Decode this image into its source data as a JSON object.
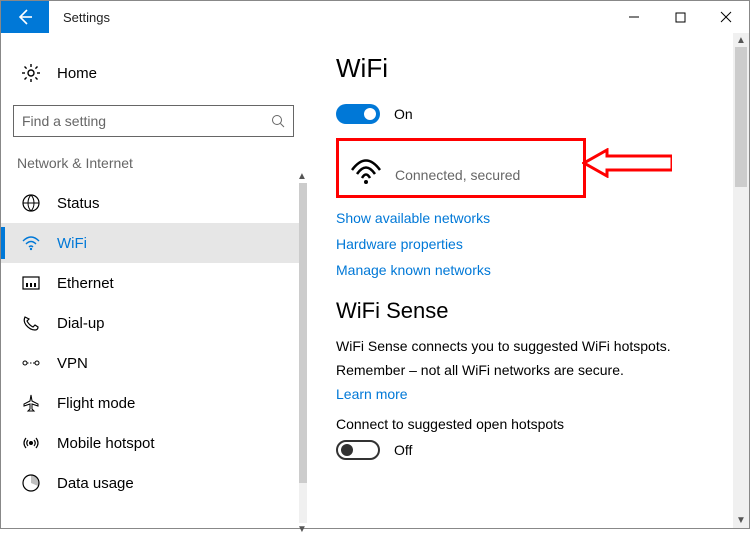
{
  "window": {
    "title": "Settings"
  },
  "sidebar": {
    "home_label": "Home",
    "search_placeholder": "Find a setting",
    "category": "Network & Internet",
    "items": [
      {
        "label": "Status",
        "icon": "status-icon"
      },
      {
        "label": "WiFi",
        "icon": "wifi-icon",
        "active": true
      },
      {
        "label": "Ethernet",
        "icon": "ethernet-icon"
      },
      {
        "label": "Dial-up",
        "icon": "dialup-icon"
      },
      {
        "label": "VPN",
        "icon": "vpn-icon"
      },
      {
        "label": "Flight mode",
        "icon": "airplane-icon"
      },
      {
        "label": "Mobile hotspot",
        "icon": "hotspot-icon"
      },
      {
        "label": "Data usage",
        "icon": "data-usage-icon"
      }
    ]
  },
  "main": {
    "title": "WiFi",
    "toggle_on_label": "On",
    "current_network_status": "Connected, secured",
    "links": {
      "show_networks": "Show available networks",
      "hardware_properties": "Hardware properties",
      "manage_networks": "Manage known networks",
      "learn_more": "Learn more"
    },
    "wifi_sense": {
      "title": "WiFi Sense",
      "description": "WiFi Sense connects you to suggested WiFi hotspots.",
      "warning": "Remember – not all WiFi networks are secure.",
      "connect_suggested_label": "Connect to suggested open hotspots",
      "connect_suggested_state": "Off"
    }
  }
}
